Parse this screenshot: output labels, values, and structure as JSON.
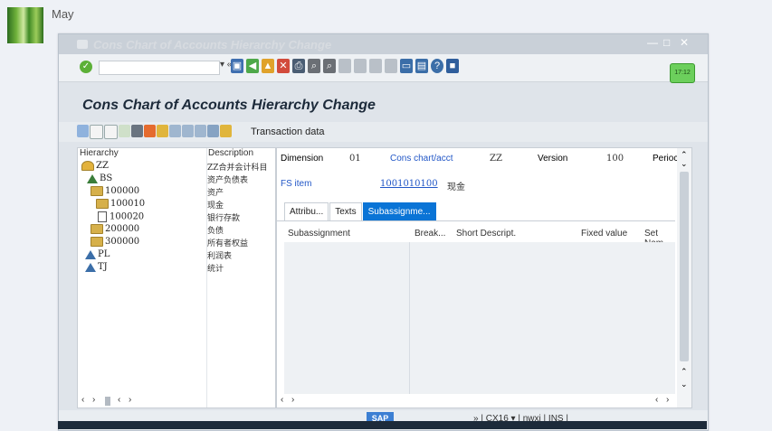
{
  "chat": {
    "sender": "May"
  },
  "window": {
    "title": "Cons Chart of Accounts Hierarchy Change"
  },
  "page_title": "Cons Chart of Accounts Hierarchy Change",
  "app_toolbar": {
    "transaction_label": "Transaction data"
  },
  "tree": {
    "columns": [
      "Hierarchy",
      "Description"
    ],
    "rows": [
      {
        "node": "ZZ",
        "desc": "ZZ合并会计科目"
      },
      {
        "node": "BS",
        "desc": "资产负债表"
      },
      {
        "node": "100000",
        "desc": "资产"
      },
      {
        "node": "100010",
        "desc": "现金"
      },
      {
        "node": "100020",
        "desc": "银行存款"
      },
      {
        "node": "200000",
        "desc": "负债"
      },
      {
        "node": "300000",
        "desc": "所有者权益"
      },
      {
        "node": "PL",
        "desc": "利润表"
      },
      {
        "node": "TJ",
        "desc": "统计"
      }
    ]
  },
  "header_fields": {
    "dimension_label": "Dimension",
    "dimension_value": "01",
    "chart_label": "Cons chart/acct",
    "chart_value": "ZZ",
    "version_label": "Version",
    "version_value": "100",
    "period_label": "Perioc"
  },
  "fs_item": {
    "label": "FS item",
    "value": "1001010100",
    "desc": "现金"
  },
  "tabs": [
    "Attribu...",
    "Texts",
    "Subassignme..."
  ],
  "grid": {
    "columns": [
      "Subassignment",
      "Break...",
      "Short Descript.",
      "Fixed value",
      "Set Nam"
    ]
  },
  "status": {
    "system": "CX16",
    "client": "nwxi",
    "mode": "INS"
  },
  "clock_text": "17:12"
}
